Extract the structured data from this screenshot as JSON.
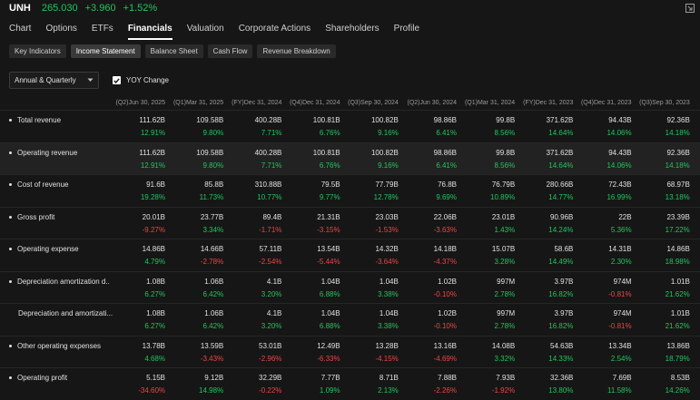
{
  "quote": {
    "ticker": "UNH",
    "price": "265.030",
    "change": "+3.960",
    "change_pct": "+1.52%"
  },
  "nav_tabs": [
    "Chart",
    "Options",
    "ETFs",
    "Financials",
    "Valuation",
    "Corporate Actions",
    "Shareholders",
    "Profile"
  ],
  "active_nav_tab": "Financials",
  "sub_tabs": [
    "Key Indicators",
    "Income Statement",
    "Balance Sheet",
    "Cash Flow",
    "Revenue Breakdown"
  ],
  "active_sub_tab": "Income Statement",
  "controls": {
    "period_select": "Annual & Quarterly",
    "yoy_label": "YOY Change",
    "yoy_checked": true
  },
  "columns": [
    "(Q2)Jun 30, 2025",
    "(Q1)Mar 31, 2025",
    "(FY)Dec 31, 2024",
    "(Q4)Dec 31, 2024",
    "(Q3)Sep 30, 2024",
    "(Q2)Jun 30, 2024",
    "(Q1)Mar 31, 2024",
    "(FY)Dec 31, 2023",
    "(Q4)Dec 31, 2023",
    "(Q3)Sep 30, 2023"
  ],
  "rows": [
    {
      "label": "Total revenue",
      "bullet": true,
      "values": [
        "111.62B",
        "109.58B",
        "400.28B",
        "100.81B",
        "100.82B",
        "98.86B",
        "99.8B",
        "371.62B",
        "94.43B",
        "92.36B"
      ],
      "yoy": [
        "12.91%",
        "9.80%",
        "7.71%",
        "6.76%",
        "9.16%",
        "6.41%",
        "8.56%",
        "14.64%",
        "14.06%",
        "14.18%"
      ]
    },
    {
      "label": "Operating revenue",
      "bullet": true,
      "values": [
        "111.62B",
        "109.58B",
        "400.28B",
        "100.81B",
        "100.82B",
        "98.86B",
        "99.8B",
        "371.62B",
        "94.43B",
        "92.36B"
      ],
      "yoy": [
        "12.91%",
        "9.80%",
        "7.71%",
        "6.76%",
        "9.16%",
        "6.41%",
        "8.56%",
        "14.64%",
        "14.06%",
        "14.18%"
      ]
    },
    {
      "label": "Cost of revenue",
      "bullet": true,
      "values": [
        "91.6B",
        "85.8B",
        "310.88B",
        "79.5B",
        "77.79B",
        "76.8B",
        "76.79B",
        "280.66B",
        "72.43B",
        "68.97B"
      ],
      "yoy": [
        "19.28%",
        "11.73%",
        "10.77%",
        "9.77%",
        "12.78%",
        "9.69%",
        "10.89%",
        "14.77%",
        "16.99%",
        "13.18%"
      ]
    },
    {
      "label": "Gross profit",
      "bullet": true,
      "values": [
        "20.01B",
        "23.77B",
        "89.4B",
        "21.31B",
        "23.03B",
        "22.06B",
        "23.01B",
        "90.96B",
        "22B",
        "23.39B"
      ],
      "yoy": [
        "-9.27%",
        "3.34%",
        "-1.71%",
        "-3.15%",
        "-1.53%",
        "-3.63%",
        "1.43%",
        "14.24%",
        "5.36%",
        "17.22%"
      ]
    },
    {
      "label": "Operating expense",
      "bullet": true,
      "values": [
        "14.86B",
        "14.66B",
        "57.11B",
        "13.54B",
        "14.32B",
        "14.18B",
        "15.07B",
        "58.6B",
        "14.31B",
        "14.86B"
      ],
      "yoy": [
        "4.79%",
        "-2.78%",
        "-2.54%",
        "-5.44%",
        "-3.64%",
        "-4.37%",
        "3.28%",
        "14.49%",
        "2.30%",
        "18.98%"
      ]
    },
    {
      "label": "Depreciation amortization d...",
      "bullet": true,
      "values": [
        "1.08B",
        "1.06B",
        "4.1B",
        "1.04B",
        "1.04B",
        "1.02B",
        "997M",
        "3.97B",
        "974M",
        "1.01B"
      ],
      "yoy": [
        "6.27%",
        "6.42%",
        "3.20%",
        "6.88%",
        "3.38%",
        "-0.10%",
        "2.78%",
        "16.82%",
        "-0.81%",
        "21.62%"
      ]
    },
    {
      "label": "Depreciation and amortizati...",
      "bullet": false,
      "values": [
        "1.08B",
        "1.06B",
        "4.1B",
        "1.04B",
        "1.04B",
        "1.02B",
        "997M",
        "3.97B",
        "974M",
        "1.01B"
      ],
      "yoy": [
        "6.27%",
        "6.42%",
        "3.20%",
        "6.88%",
        "3.38%",
        "-0.10%",
        "2.78%",
        "16.82%",
        "-0.81%",
        "21.62%"
      ]
    },
    {
      "label": "Other operating expenses",
      "bullet": true,
      "values": [
        "13.78B",
        "13.59B",
        "53.01B",
        "12.49B",
        "13.28B",
        "13.16B",
        "14.08B",
        "54.63B",
        "13.34B",
        "13.86B"
      ],
      "yoy": [
        "4.68%",
        "-3.43%",
        "-2.96%",
        "-6.33%",
        "-4.15%",
        "-4.69%",
        "3.32%",
        "14.33%",
        "2.54%",
        "18.79%"
      ]
    },
    {
      "label": "Operating profit",
      "bullet": true,
      "values": [
        "5.15B",
        "9.12B",
        "32.29B",
        "7.77B",
        "8.71B",
        "7.88B",
        "7.93B",
        "32.36B",
        "7.69B",
        "8.53B"
      ],
      "yoy": [
        "-34.60%",
        "14.98%",
        "-0.22%",
        "1.09%",
        "2.13%",
        "-2.26%",
        "-1.92%",
        "13.80%",
        "11.58%",
        "14.26%"
      ]
    }
  ],
  "colors": {
    "positive": "#22c55e",
    "negative": "#ef4444",
    "background": "#161616"
  }
}
